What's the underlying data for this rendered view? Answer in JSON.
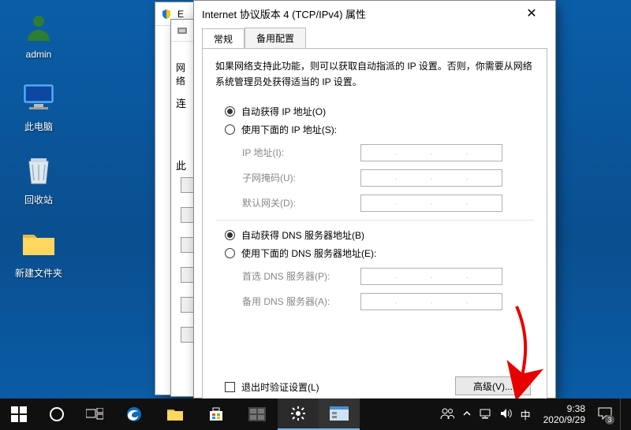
{
  "desktop": {
    "icons": [
      {
        "label": "admin"
      },
      {
        "label": "此电脑"
      },
      {
        "label": "回收站"
      },
      {
        "label": "新建文件夹"
      }
    ]
  },
  "back_window_1": {
    "title_prefix": "E"
  },
  "back_window_2": {
    "tab_label": "网络",
    "section_label": "连",
    "section_label_2": "此"
  },
  "dialog": {
    "title": "Internet 协议版本 4 (TCP/IPv4) 属性",
    "tabs": {
      "general": "常规",
      "alternate": "备用配置"
    },
    "description": "如果网络支持此功能，则可以获取自动指派的 IP 设置。否则，你需要从网络系统管理员处获得适当的 IP 设置。",
    "ip": {
      "auto": "自动获得 IP 地址(O)",
      "manual": "使用下面的 IP 地址(S):",
      "fields": {
        "address": "IP 地址(I):",
        "subnet": "子网掩码(U):",
        "gateway": "默认网关(D):"
      }
    },
    "dns": {
      "auto": "自动获得 DNS 服务器地址(B)",
      "manual": "使用下面的 DNS 服务器地址(E):",
      "fields": {
        "preferred": "首选 DNS 服务器(P):",
        "alternate": "备用 DNS 服务器(A):"
      }
    },
    "validate_on_exit": "退出时验证设置(L)",
    "advanced_button": "高级(V)..."
  },
  "taskbar": {
    "ime": "中",
    "clock": {
      "time": "9:38",
      "date": "2020/9/29"
    },
    "notification_count": "3"
  }
}
